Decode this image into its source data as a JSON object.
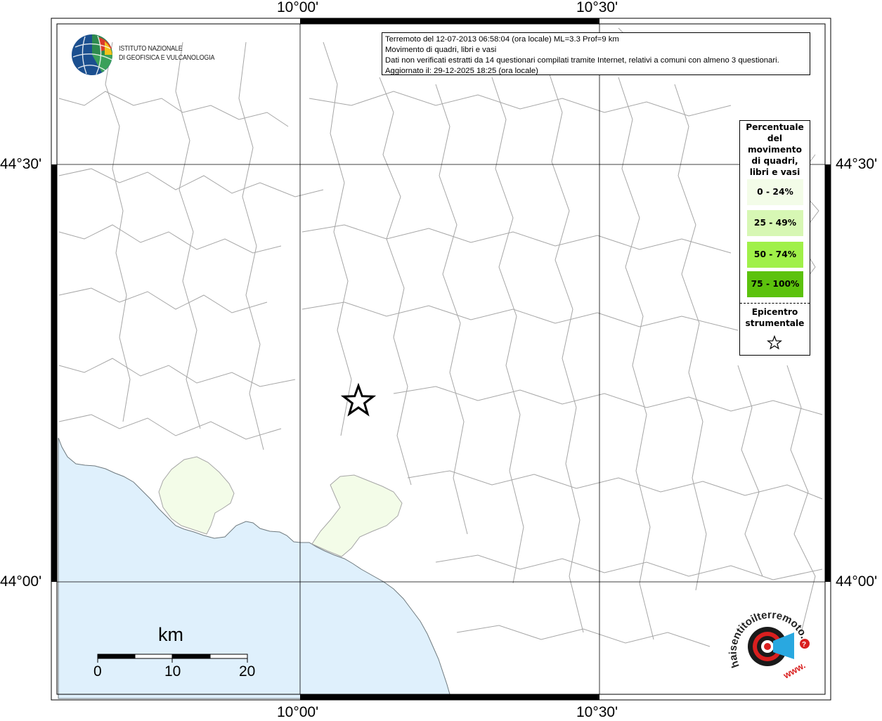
{
  "map": {
    "grid_labels": {
      "top": [
        "10°00'",
        "10°30'"
      ],
      "bottom": [
        "10°00'",
        "10°30'"
      ],
      "left": [
        "44°30'",
        "44°00'"
      ],
      "right": [
        "44°30'",
        "44°00'"
      ]
    },
    "colors": {
      "sea": "#dff0fc",
      "land": "#ffffff",
      "boundaries": "#a6a6a6",
      "class_0_24": "#f3fce8",
      "class_25_49": "#d7f7b4",
      "class_50_74": "#a0f049",
      "class_75_100": "#5cc20d"
    }
  },
  "info": {
    "line1": "Terremoto del 12-07-2013 06:58:04 (ora locale) ML=3.3 Prof=9 km",
    "line2": "Movimento di quadri, libri e vasi",
    "line3": "Dati non verificati estratti da 14 questionari compilati tramite Internet, relativi a comuni con almeno 3 questionari.",
    "line4": "Aggiornato il: 29-12-2025 18:25 (ora locale)"
  },
  "legend": {
    "title_lines": [
      "Percentuale",
      "del",
      "movimento",
      "di quadri,",
      "libri e vasi"
    ],
    "items": [
      {
        "label": "0 - 24%",
        "color": "#f3fce8"
      },
      {
        "label": "25 - 49%",
        "color": "#d7f7b4"
      },
      {
        "label": "50 - 74%",
        "color": "#a0f049"
      },
      {
        "label": "75 - 100%",
        "color": "#5cc20d"
      }
    ],
    "epicenter_lines": [
      "Epicentro",
      "strumentale"
    ],
    "epicenter_icon": "star-icon"
  },
  "logo": {
    "line1": "ISTITUTO NAZIONALE",
    "line2": "DI GEOFISICA E VULCANOLOGIA"
  },
  "scalebar": {
    "title": "km",
    "ticks": [
      "0",
      "10",
      "20"
    ]
  },
  "hst_logo": {
    "text": "haisentitoilterremoto.it",
    "sub": "www."
  }
}
